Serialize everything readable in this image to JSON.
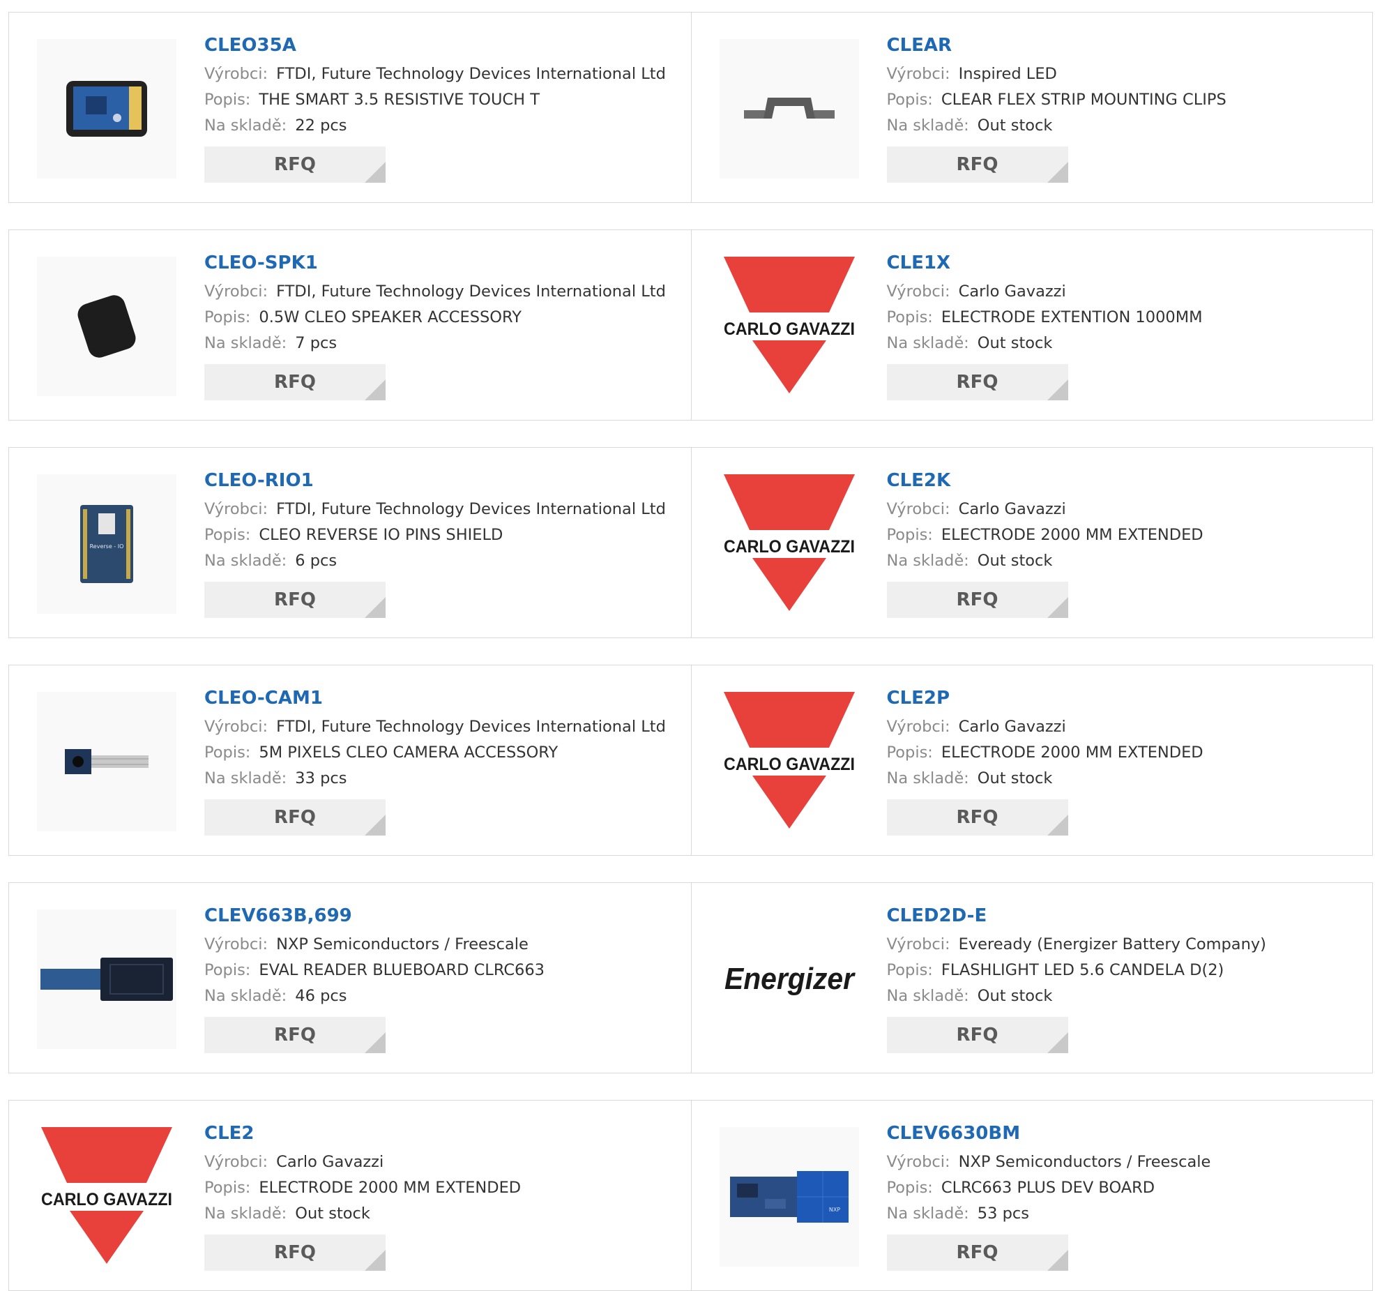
{
  "labels": {
    "maker": "Výrobci:",
    "desc": "Popis:",
    "stock": "Na skladě:",
    "rfq": "RFQ"
  },
  "colors": {
    "link": "#1f69b4",
    "carlo_red": "#e8403a",
    "button_bg": "#efefef"
  },
  "rows": [
    [
      {
        "pn": "CLEO35A",
        "maker": "FTDI, Future Technology Devices International Ltd",
        "desc": "THE SMART 3.5 RESISTIVE TOUCH T",
        "stock": "22 pcs",
        "image": "touch-display-module-image"
      },
      {
        "pn": "CLEAR",
        "maker": "Inspired LED",
        "desc": "CLEAR FLEX STRIP MOUNTING CLIPS",
        "stock": "Out stock",
        "image": "mounting-clip-image"
      }
    ],
    [
      {
        "pn": "CLEO-SPK1",
        "maker": "FTDI, Future Technology Devices International Ltd",
        "desc": "0.5W CLEO SPEAKER ACCESSORY",
        "stock": "7 pcs",
        "image": "speaker-image"
      },
      {
        "pn": "CLE1X",
        "maker": "Carlo Gavazzi",
        "desc": "ELECTRODE EXTENTION 1000MM",
        "stock": "Out stock",
        "image": "carlo-gavazzi-logo",
        "logo_text": "CARLO GAVAZZI"
      }
    ],
    [
      {
        "pn": "CLEO-RIO1",
        "maker": "FTDI, Future Technology Devices International Ltd",
        "desc": "CLEO REVERSE IO PINS SHIELD",
        "stock": "6 pcs",
        "image": "shield-board-image",
        "board_text": "Reverse - IO"
      },
      {
        "pn": "CLE2K",
        "maker": "Carlo Gavazzi",
        "desc": "ELECTRODE 2000 MM EXTENDED",
        "stock": "Out stock",
        "image": "carlo-gavazzi-logo",
        "logo_text": "CARLO GAVAZZI"
      }
    ],
    [
      {
        "pn": "CLEO-CAM1",
        "maker": "FTDI, Future Technology Devices International Ltd",
        "desc": "5M PIXELS CLEO CAMERA ACCESSORY",
        "stock": "33 pcs",
        "image": "camera-module-image"
      },
      {
        "pn": "CLE2P",
        "maker": "Carlo Gavazzi",
        "desc": "ELECTRODE 2000 MM EXTENDED",
        "stock": "Out stock",
        "image": "carlo-gavazzi-logo",
        "logo_text": "CARLO GAVAZZI"
      }
    ],
    [
      {
        "pn": "CLEV663B,699",
        "maker": "NXP Semiconductors / Freescale",
        "desc": "EVAL READER BLUEBOARD CLRC663",
        "stock": "46 pcs",
        "image": "reader-board-image"
      },
      {
        "pn": "CLED2D-E",
        "maker": "Eveready (Energizer Battery Company)",
        "desc": "FLASHLIGHT LED 5.6 CANDELA D(2)",
        "stock": "Out stock",
        "image": "energizer-logo",
        "logo_text": "Energizer"
      }
    ],
    [
      {
        "pn": "CLE2",
        "maker": "Carlo Gavazzi",
        "desc": "ELECTRODE 2000 MM EXTENDED",
        "stock": "Out stock",
        "image": "carlo-gavazzi-logo",
        "logo_text": "CARLO GAVAZZI"
      },
      {
        "pn": "CLEV6630BM",
        "maker": "NXP Semiconductors / Freescale",
        "desc": "CLRC663 PLUS DEV BOARD",
        "stock": "53 pcs",
        "image": "dev-board-image",
        "board_text": "NXP"
      }
    ]
  ]
}
